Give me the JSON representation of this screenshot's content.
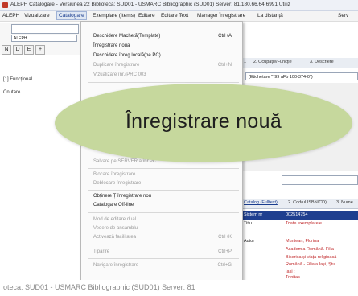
{
  "window": {
    "title": "ALEPH Catalogare - Versiunea 22 Biblioteca: SUD01 - USMARC Bibliographic (SUD01) Server: 81.180.66.64:6991 Utiliz"
  },
  "menubar": {
    "items": [
      "ALEPH",
      "Vizualizare",
      "Catalogare",
      "Exemplare (Items)",
      "Editare",
      "Editare Text",
      "Manager Înregistrare",
      "La distanță",
      "Serv"
    ]
  },
  "toolbar": {
    "field1_value": "",
    "field2_value": "ALEPH",
    "button_labels": [
      "N",
      "D",
      "E",
      "+"
    ]
  },
  "left_pane": {
    "tree_item_1": "[1] Funcțional",
    "tree_item_2": "Cnutare"
  },
  "catalogare_menu": {
    "items": [
      {
        "label": "Deschidere Machetă(Template)",
        "shortcut": "Ctrl+A",
        "enabled": true
      },
      {
        "label": "Înregistrare nouă",
        "shortcut": "",
        "enabled": true
      },
      {
        "label": "Deschidere înreg.locală(pe PC)",
        "shortcut": "",
        "enabled": true
      },
      {
        "label": "Duplicare înregistrare",
        "shortcut": "Ctrl+N",
        "enabled": false
      },
      {
        "label": "Vizualizare înr.(PRC 003",
        "shortcut": "",
        "enabled": false
      },
      {
        "label": "Salvare pe SERVER a înr.PC",
        "shortcut": "Ctrl+L",
        "enabled": false
      },
      {
        "label": "Blocare înregistrare",
        "shortcut": "",
        "enabled": false
      },
      {
        "label": "Deblocare înregistrare",
        "shortcut": "",
        "enabled": false
      },
      {
        "label": "Obținere Ț înregistrare nou",
        "shortcut": "",
        "enabled": true
      },
      {
        "label": "Catalogare Off-line",
        "shortcut": "",
        "enabled": true
      },
      {
        "label": "Mod de editare dual",
        "shortcut": "",
        "enabled": false
      },
      {
        "label": "Vedere de ansamblu",
        "shortcut": "",
        "enabled": false
      },
      {
        "label": "Activează facilitatea",
        "shortcut": "Ctrl+K",
        "enabled": false
      },
      {
        "label": "Tipărire",
        "shortcut": "Ctrl+P",
        "enabled": false
      },
      {
        "label": "Navigare înregistrare",
        "shortcut": "Ctrl+G",
        "enabled": false
      }
    ]
  },
  "right_pane": {
    "tabs": [
      "1",
      "2. Ocupație/Funcție",
      "3. Descriere"
    ],
    "filter_value": "(Etichetare \"*99 aFb 100-374-0\")",
    "tabs2": [
      "Catalog (Fulltext)",
      "2. Cod(ul ISBN/CD)",
      "3. Nume"
    ],
    "records": [
      {
        "key": "Sistem nr",
        "value": "002514754",
        "highlight": true
      },
      {
        "key": "Titlu",
        "value": "Toate exemplarele",
        "highlight": false
      },
      {
        "key": "",
        "value": "",
        "highlight": false
      },
      {
        "key": "Autor",
        "value": "Muntean, Florina",
        "highlight": false
      },
      {
        "key": "",
        "value": "Academia Română. Filia",
        "highlight": false
      },
      {
        "key": "",
        "value": "Biserica și viața religioasă",
        "highlight": false
      },
      {
        "key": "",
        "value": "Română - Filiala Iași, Ștu",
        "highlight": false
      },
      {
        "key": "",
        "value": "Iași ;",
        "highlight": false
      },
      {
        "key": "",
        "value": "Trinitas",
        "highlight": false
      }
    ]
  },
  "statusbar": {
    "text": "oteca: SUD01 - USMARC Bibliographic (SUD01) Server: 81"
  },
  "callout": {
    "text": "Înregistrare nouă",
    "color": "#c6d89d"
  }
}
